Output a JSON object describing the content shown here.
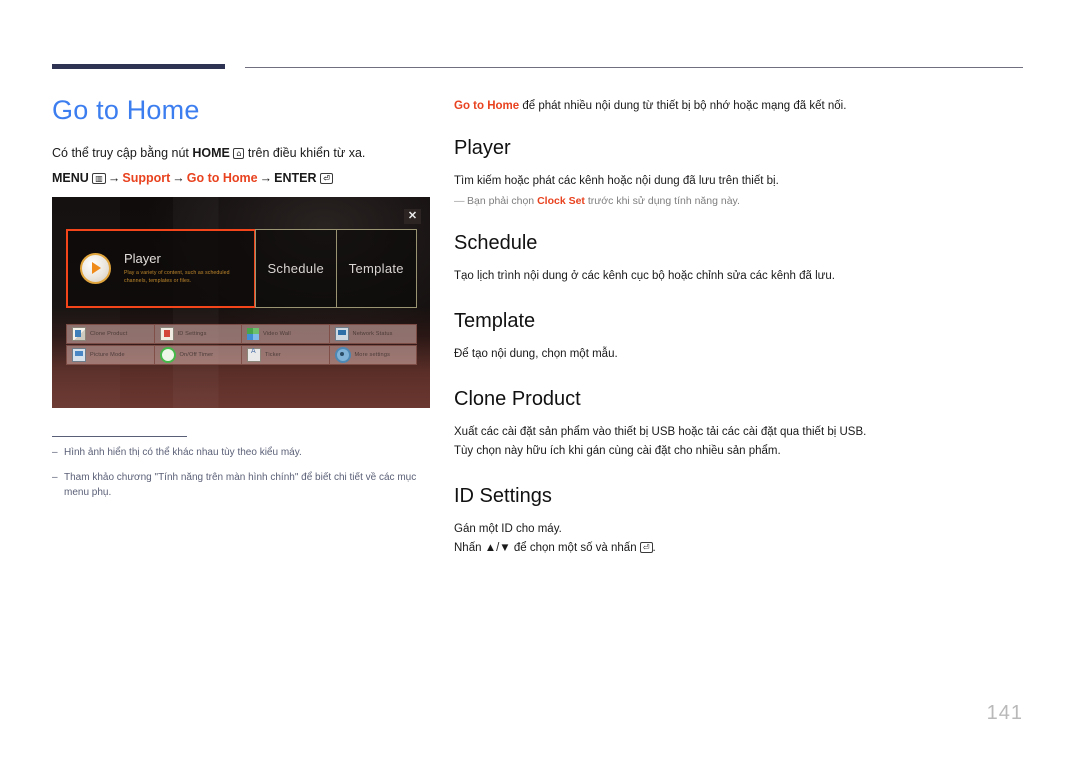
{
  "header": {
    "title": "Go to Home",
    "title_color": "#3c7ef0",
    "rule_color": "#2e3253"
  },
  "left": {
    "access_prefix": "Có thể truy cập bằng nút ",
    "access_home_label": "HOME",
    "home_icon": "home-glyph",
    "access_suffix": " trên điều khiển từ xa.",
    "menu_path": {
      "menu_label": "MENU",
      "menu_icon": "menu-glyph",
      "arrow": "→",
      "step1": "Support",
      "step2": "Go to Home",
      "enter_label": "ENTER",
      "enter_icon": "enter-glyph"
    }
  },
  "tv_screenshot": {
    "close_icon": "close-icon",
    "tiles": [
      {
        "name": "Player",
        "icon": "play-circle-icon",
        "description": "Play a variety of content, such as scheduled channels, templates or files.",
        "selected": true
      },
      {
        "name": "Schedule",
        "selected": false
      },
      {
        "name": "Template",
        "selected": false
      }
    ],
    "menu_grid": [
      {
        "label": "Clone Product",
        "icon": "clone-product-icon"
      },
      {
        "label": "ID Settings",
        "icon": "id-settings-icon"
      },
      {
        "label": "Video Wall",
        "icon": "video-wall-icon"
      },
      {
        "label": "Network Status",
        "icon": "network-status-icon"
      },
      {
        "label": "Picture Mode",
        "icon": "picture-mode-icon"
      },
      {
        "label": "On/Off Timer",
        "icon": "on-off-timer-icon"
      },
      {
        "label": "Ticker",
        "icon": "ticker-icon"
      },
      {
        "label": "More settings",
        "icon": "more-settings-icon"
      }
    ],
    "selection_color": "#f4441a"
  },
  "footnotes": [
    {
      "dash": "‒",
      "text": "Hình ảnh hiển thị có thể khác nhau tùy theo kiểu máy."
    },
    {
      "dash": "‒",
      "text": "Tham khảo chương \"Tính năng trên màn hình chính\" để biết chi tiết về các mục menu phụ."
    }
  ],
  "right": {
    "intro_link": "Go to Home",
    "intro_rest": " để phát nhiều nội dung từ thiết bị bộ nhớ hoặc mạng đã kết nối.",
    "sections": [
      {
        "title": "Player",
        "body": "Tìm kiếm hoặc phát các kênh hoặc nội dung đã lưu trên thiết bị.",
        "note_dash": "—",
        "note_prefix": "Bạn phải chọn ",
        "note_highlight": "Clock Set",
        "note_suffix": " trước khi sử dụng tính năng này."
      },
      {
        "title": "Schedule",
        "body": "Tạo lịch trình nội dung ở các kênh cục bộ hoặc chỉnh sửa các kênh đã lưu."
      },
      {
        "title": "Template",
        "body": "Để tạo nội dung, chọn một mẫu."
      },
      {
        "title": "Clone Product",
        "body": "Xuất các cài đặt sản phẩm vào thiết bị USB hoặc tải các cài đặt qua thiết bị USB.",
        "body2": "Tùy chọn này hữu ích khi gán cùng cài đặt cho nhiều sản phẩm."
      },
      {
        "title": "ID Settings",
        "body": "Gán một ID cho máy.",
        "body2_prefix": "Nhấn ",
        "body2_keys": "▲/▼",
        "body2_mid": " để chọn một số và nhấn ",
        "body2_icon": "enter-glyph",
        "body2_suffix": "."
      }
    ],
    "accent_color": "#e8421f"
  },
  "page_number": "141"
}
